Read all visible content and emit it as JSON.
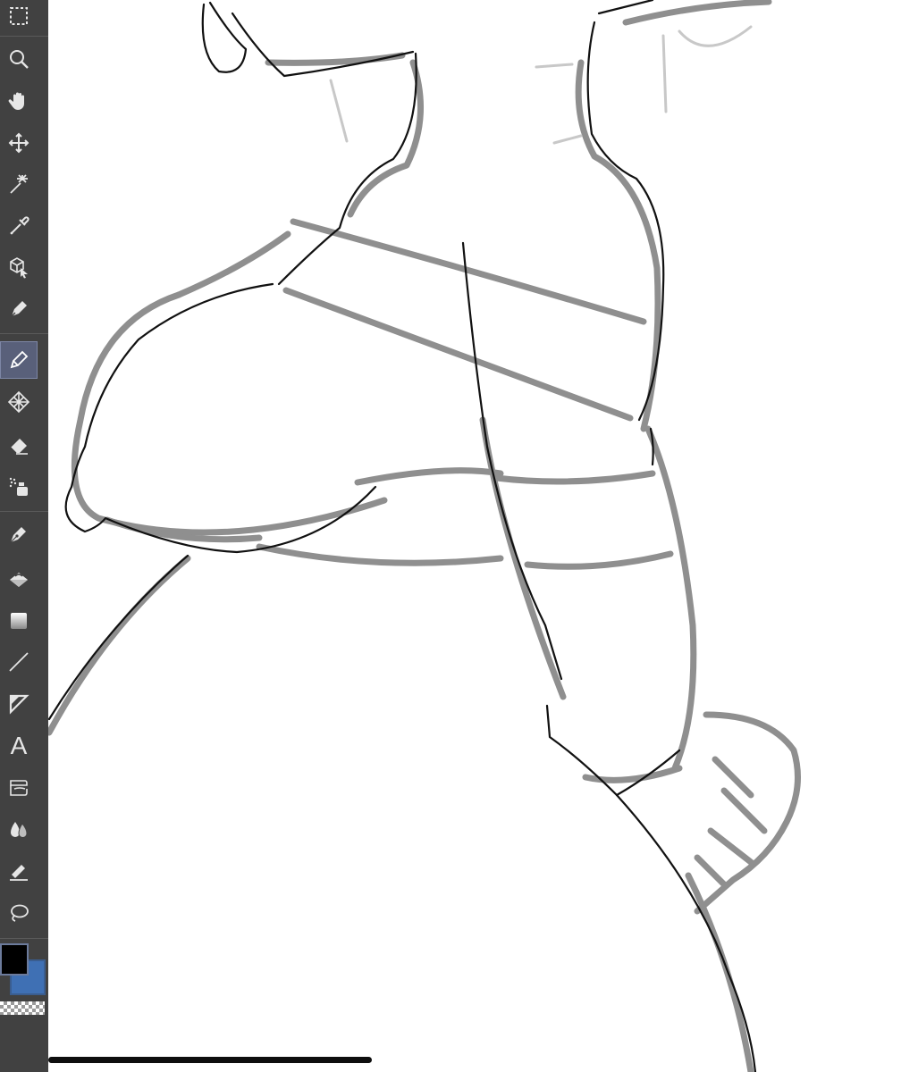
{
  "toolbar": {
    "tools": [
      {
        "name": "marquee-selection-icon",
        "active": false
      },
      {
        "name": "zoom-icon",
        "active": false
      },
      {
        "name": "hand-icon",
        "active": false
      },
      {
        "name": "move-icon",
        "active": false
      },
      {
        "name": "magic-wand-icon",
        "active": false
      },
      {
        "name": "eyedropper-icon",
        "active": false
      },
      {
        "name": "3d-object-icon",
        "active": false
      },
      {
        "name": "pen-icon",
        "active": false
      },
      {
        "name": "pencil-icon",
        "active": true
      },
      {
        "name": "pattern-brush-icon",
        "active": false
      },
      {
        "name": "eraser-icon",
        "active": false
      },
      {
        "name": "airbrush-icon",
        "active": false
      },
      {
        "name": "vector-pen-icon",
        "active": false
      },
      {
        "name": "fill-icon",
        "active": false
      },
      {
        "name": "gradient-icon",
        "active": false
      },
      {
        "name": "line-icon",
        "active": false
      },
      {
        "name": "frame-icon",
        "active": false
      },
      {
        "name": "text-tool-icon",
        "active": false
      },
      {
        "name": "balloon-icon",
        "active": false
      },
      {
        "name": "blend-icon",
        "active": false
      },
      {
        "name": "correct-line-icon",
        "active": false
      },
      {
        "name": "lasso-icon",
        "active": false
      }
    ],
    "text_tool_glyph": "A",
    "colors": {
      "main": "#000000",
      "sub": "#3f70b4",
      "toolbar_bg": "#414141",
      "active_tool_bg": "#59607a"
    }
  }
}
